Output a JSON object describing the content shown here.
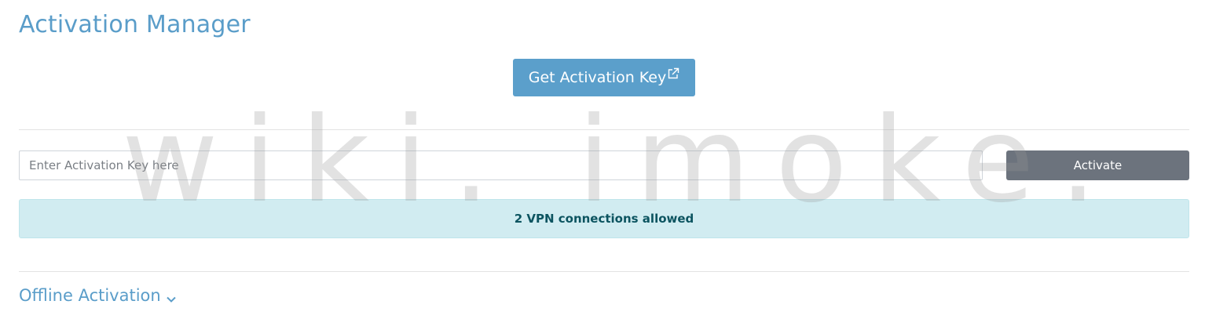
{
  "header": {
    "title": "Activation Manager"
  },
  "get_key_button": {
    "label": "Get Activation Key",
    "icon": "external-link-icon"
  },
  "activation_form": {
    "input_value": "",
    "input_placeholder": "Enter Activation Key here",
    "activate_label": "Activate"
  },
  "status": {
    "message": "2 VPN connections allowed"
  },
  "offline": {
    "label": "Offline Activation",
    "icon": "chevron-down-icon"
  },
  "watermark": {
    "text": "wiki. imoke. org"
  },
  "colors": {
    "accent": "#5a9dc9",
    "primary_button": "#5b9fcb",
    "secondary_button": "#6c737d",
    "info_bg": "#d1ecf1",
    "info_text": "#0c5460"
  }
}
